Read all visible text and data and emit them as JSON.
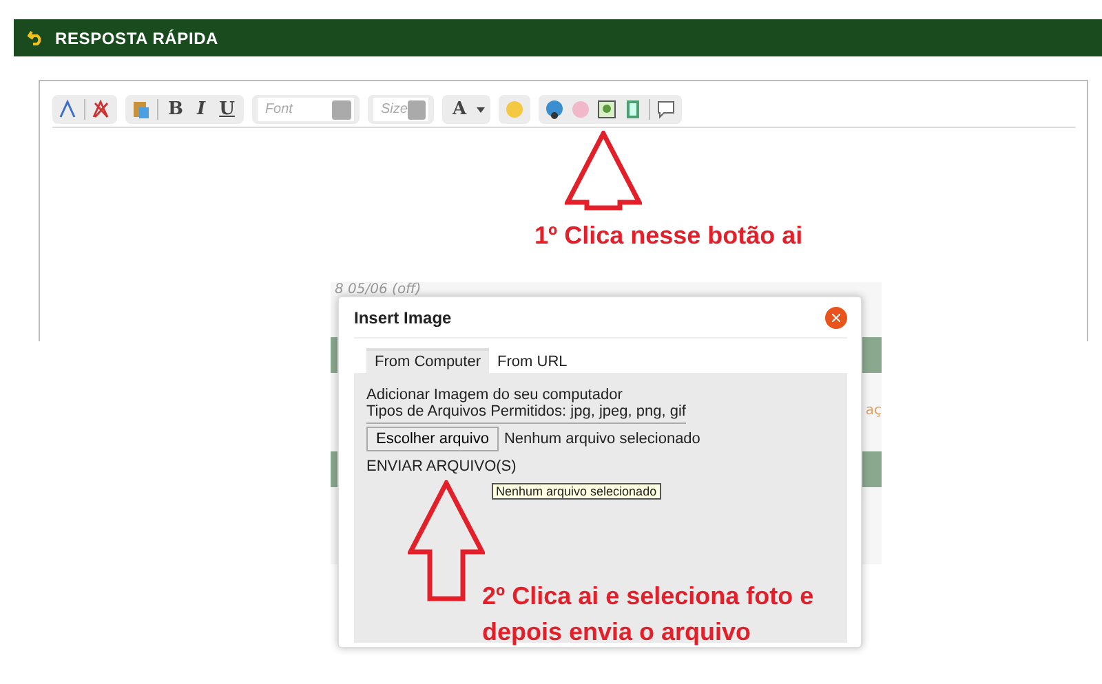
{
  "header": {
    "title": "RESPOSTA RÁPIDA"
  },
  "toolbar": {
    "bold": "B",
    "italic": "I",
    "underline": "U",
    "font": "Font",
    "size": "Size",
    "text_color_letter": "A"
  },
  "annotations": [
    {
      "text": "1º Clica nesse botão ai"
    },
    {
      "text": "2º Clica ai e seleciona foto e depois envia o arquivo"
    }
  ],
  "background_fragments": [
    "8 05/06 (off)",
    "aç"
  ],
  "dialog": {
    "title": "Insert Image",
    "tabs": [
      {
        "label": "From Computer",
        "selected": true
      },
      {
        "label": "From URL",
        "selected": false
      }
    ],
    "lines": [
      "Adicionar Imagem do seu computador",
      "Tipos de Arquivos Permitidos: jpg, jpeg, png, gif"
    ],
    "file_button": "Escolher arquivo",
    "file_status": "Nenhum arquivo selecionado",
    "upload_label": "ENVIAR ARQUIVO(S)",
    "tooltip": "Nenhum arquivo selecionado"
  }
}
